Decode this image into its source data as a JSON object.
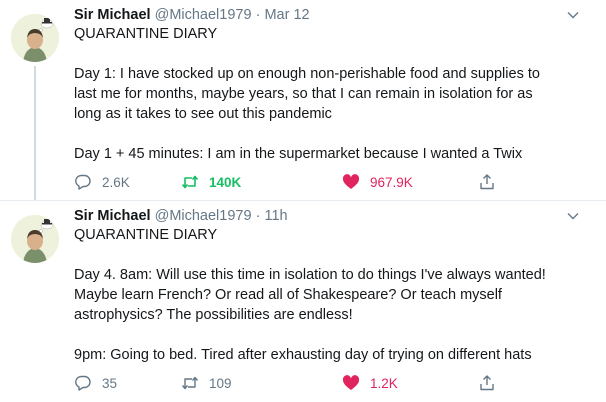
{
  "colors": {
    "retweet_active": "#17bf63",
    "like_active": "#e0245e",
    "muted": "#657786"
  },
  "tweets": [
    {
      "name": "Sir Michael",
      "handle": "@Michael1979",
      "separator": "·",
      "time": "Mar 12",
      "lines": [
        "QUARANTINE DIARY",
        "",
        "Day 1: I have stocked up on enough non-perishable food and supplies to",
        "last me for months, maybe years, so that I can remain in isolation for as",
        "long as it takes to see out this pandemic",
        "",
        "Day 1 + 45 minutes: I am in the supermarket because I wanted a Twix"
      ],
      "replies": "2.6K",
      "retweets": "140K",
      "likes": "967.9K",
      "retweeted": true,
      "liked": true
    },
    {
      "name": "Sir Michael",
      "handle": "@Michael1979",
      "separator": "·",
      "time": "11h",
      "lines": [
        "QUARANTINE DIARY",
        "",
        "Day 4. 8am: Will use this time in isolation to do things I've always wanted!",
        "Maybe learn French? Or read all of Shakespeare? Or teach myself",
        "astrophysics? The possibilities are endless!",
        "",
        "9pm: Going to bed. Tired after exhausting day of trying on different hats"
      ],
      "replies": "35",
      "retweets": "109",
      "likes": "1.2K",
      "retweeted": false,
      "liked": true
    }
  ]
}
